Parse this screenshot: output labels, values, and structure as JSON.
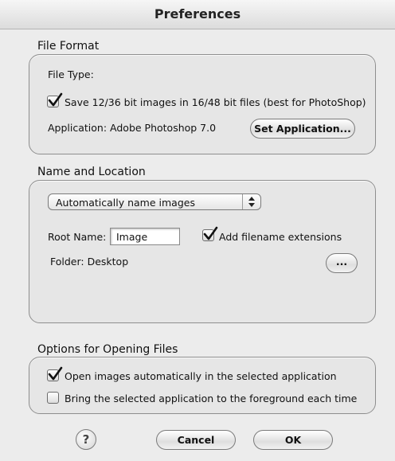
{
  "window": {
    "title": "Preferences"
  },
  "file_format": {
    "heading": "File Format",
    "file_type_label": "File Type:",
    "save_16bit_label": "Save 12/36 bit images in 16/48 bit files (best for PhotoShop)",
    "save_16bit_checked": true,
    "application_label": "Application: Adobe Photoshop 7.0",
    "set_application_button": "Set Application..."
  },
  "name_location": {
    "heading": "Name and Location",
    "naming_popup_value": "Automatically name images",
    "root_name_label": "Root Name:",
    "root_name_value": "Image",
    "add_extensions_label": "Add filename extensions",
    "add_extensions_checked": true,
    "folder_label": "Folder: Desktop",
    "browse_button": "..."
  },
  "opening_options": {
    "heading": "Options for Opening Files",
    "open_automatically_label": "Open images automatically in the selected application",
    "open_automatically_checked": true,
    "bring_foreground_label": "Bring the selected application to the foreground each time",
    "bring_foreground_checked": false
  },
  "footer": {
    "help_glyph": "?",
    "cancel_button": "Cancel",
    "ok_button": "OK"
  }
}
